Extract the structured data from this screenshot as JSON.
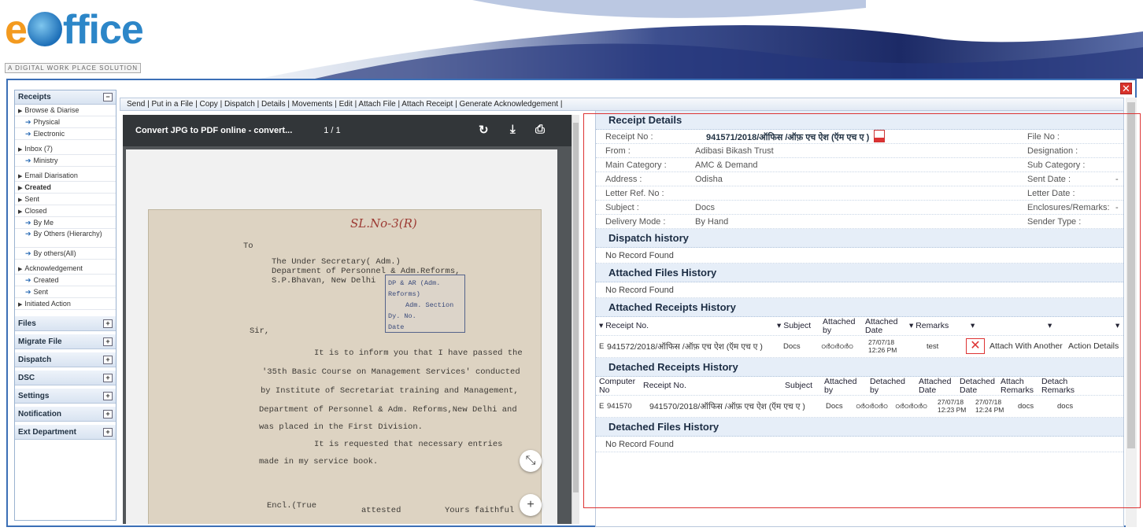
{
  "brand": {
    "logo_e": "e",
    "logo_rest": "ffice",
    "tagline": "A DIGITAL WORK PLACE SOLUTION"
  },
  "sidebar": {
    "receipts_title": "Receipts",
    "items": [
      {
        "label": "Browse & Diarise"
      },
      {
        "label": "Physical"
      },
      {
        "label": "Electronic"
      },
      {
        "label": "Inbox (7)"
      },
      {
        "label": "Ministry"
      },
      {
        "label": "Email Diarisation"
      },
      {
        "label": "Created"
      },
      {
        "label": "Sent"
      },
      {
        "label": "Closed"
      },
      {
        "label": "By Me"
      },
      {
        "label": "By Others (Hierarchy)"
      },
      {
        "label": "By others(All)"
      },
      {
        "label": "Acknowledgement"
      },
      {
        "label": "Created"
      },
      {
        "label": "Sent"
      },
      {
        "label": "Initiated Action"
      }
    ],
    "sections": [
      "Files",
      "Migrate File",
      "Dispatch",
      "DSC",
      "Settings",
      "Notification",
      "Ext Department"
    ]
  },
  "toolbar": {
    "actions": "Send  |  Put in a File  |  Copy  |  Dispatch  |  Details  |  Movements  |  Edit  |     Attach File  |  Attach Receipt  |  Generate Acknowledgement  |"
  },
  "viewer": {
    "title": "Convert JPG to PDF online - convert...",
    "pages": "1 / 1",
    "doc": {
      "hw_number": "SL.No-3(R)",
      "to": "To",
      "addr1": "The Under Secretary( Adm.)",
      "addr2": "Department of Personnel & Adm.Reforms,",
      "addr3": "S.P.Bhavan, New Delhi",
      "stamp1": "DP & AR (Adm. Reforms)",
      "stamp2": "Adm. Section",
      "stamp3": "Dy. No.",
      "stamp4": "Date",
      "sir": "Sir,",
      "p1": "It is to inform you that I have passed the",
      "p2": "'35th Basic Course on Management Services' conducted",
      "p3": "by Institute of Secretariat training and Management,",
      "p4": "Department of Personnel & Adm. Reforms,New Delhi and",
      "p5": "was placed in the First Division.",
      "p6": "It is requested that necessary entries",
      "p7": "made in my service book.",
      "encl": "Encl.(True",
      "attested": "attested",
      "yours": "Yours faithful"
    }
  },
  "receipt_details": {
    "title": "Receipt Details",
    "labels": {
      "receipt_no": "Receipt No :",
      "from": "From :",
      "main_category": "Main Category :",
      "address": "Address :",
      "letter_ref": "Letter Ref. No :",
      "subject": "Subject :",
      "delivery_mode": "Delivery Mode :",
      "file_no": "File No :",
      "designation": "Designation :",
      "sub_category": "Sub Category :",
      "sent_date": "Sent Date :",
      "letter_date": "Letter Date :",
      "enclosures": "Enclosures/Remarks:",
      "sender_type": "Sender Type :"
    },
    "values": {
      "receipt_no": "941571/2018/ऑफिस /ऑफ़ एच ऐश (ऍम एच ए )",
      "from": "Adibasi Bikash Trust",
      "main_category": "AMC & Demand",
      "address": "Odisha",
      "subject": "Docs",
      "delivery_mode": "By Hand",
      "sent_date": "-",
      "enclosures": "-"
    }
  },
  "dispatch_history": {
    "title": "Dispatch history",
    "empty": "No Record Found"
  },
  "attached_files": {
    "title": "Attached Files History",
    "empty": "No Record Found"
  },
  "attached_receipts": {
    "title": "Attached Receipts History",
    "headers": {
      "receipt_no": "Receipt No.",
      "subject": "Subject",
      "attached_by": "Attached by",
      "attached_date": "Attached Date",
      "remarks": "Remarks"
    },
    "row": {
      "prefix": "E",
      "receipt_no": "941572/2018/ऑफिस /ऑफ़ एच ऐश (ऍम एच ए )",
      "subject": "Docs",
      "attached_by": "ഠർഠർഠർഠ",
      "date": "27/07/18",
      "time": "12:26 PM",
      "remarks": "test",
      "attach_another": "Attach With Another",
      "action_details": "Action Details"
    }
  },
  "detached_receipts": {
    "title": "Detached Receipts History",
    "headers": {
      "computer_no": "Computer No",
      "receipt_no": "Receipt No.",
      "subject": "Subject",
      "attached_by": "Attached by",
      "detached_by": "Detached by",
      "attached_date": "Attached Date",
      "detached_date": "Detached Date",
      "attach_remarks": "Attach Remarks",
      "detach_remarks": "Detach Remarks"
    },
    "row": {
      "prefix": "E",
      "computer_no": "941570",
      "receipt_no": "941570/2018/ऑफिस /ऑफ़ एच ऐश (ऍम एच ए )",
      "subject": "Docs",
      "attached_by": "ഠർഠർഠർഠ",
      "detached_by": "ഠർഠർഠർഠ",
      "attached_date": "27/07/18",
      "attached_time": "12:23 PM",
      "detached_date": "27/07/18",
      "detached_time": "12:24 PM",
      "attach_remarks": "docs",
      "detach_remarks": "docs"
    }
  },
  "detached_files": {
    "title": "Detached Files History",
    "empty": "No Record Found"
  }
}
